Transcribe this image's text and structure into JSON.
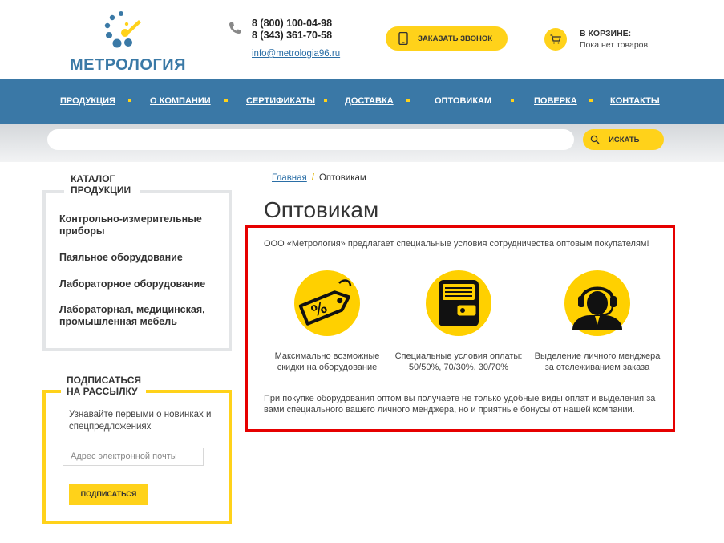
{
  "header": {
    "logo_text": "МЕТРОЛОГИЯ",
    "phone_1": "8 (800) 100-04-98",
    "phone_2": "8 (343) 361-70-58",
    "email": "info@metrologia96.ru",
    "callback_label": "ЗАКАЗАТЬ ЗВОНОК",
    "cart_title": "В КОРЗИНЕ:",
    "cart_status": "Пока нет товаров"
  },
  "nav": {
    "items": [
      {
        "label": "ПРОДУКЦИЯ"
      },
      {
        "label": "О КОМПАНИИ"
      },
      {
        "label": "СЕРТИФИКАТЫ"
      },
      {
        "label": "ДОСТАВКА"
      },
      {
        "label": "ОПТОВИКАМ"
      },
      {
        "label": "ПОВЕРКА"
      },
      {
        "label": "КОНТАКТЫ"
      }
    ]
  },
  "search": {
    "placeholder": "",
    "button_label": "ИСКАТЬ"
  },
  "catalog": {
    "title_line1": "КАТАЛОГ",
    "title_line2": "ПРОДУКЦИИ",
    "items": [
      {
        "line1": "Контрольно-измерительные",
        "line2": "приборы"
      },
      {
        "line1": "Паяльное оборудование",
        "line2": ""
      },
      {
        "line1": "Лабораторное оборудование",
        "line2": ""
      },
      {
        "line1": "Лабораторная, медицинская,",
        "line2": "промышленная мебель"
      }
    ]
  },
  "subscribe": {
    "title_line1": "ПОДПИСАТЬСЯ",
    "title_line2": "НА РАССЫЛКУ",
    "text": "Узнавайте первыми о новинках и спецпредложениях",
    "email_placeholder": "Адрес электронной почты",
    "button_label": "ПОДПИСАТЬСЯ"
  },
  "breadcrumb": {
    "home": "Главная",
    "separator": "/",
    "current": "Оптовикам"
  },
  "main": {
    "title": "Оптовикам",
    "intro": "ООО «Метрология» предлагает специальные условия сотрудничества оптовым покупателям!",
    "features": [
      {
        "icon": "discount-tag-icon",
        "line1": "Максимально возможные",
        "line2": "скидки на оборудование"
      },
      {
        "icon": "wallet-icon",
        "line1": "Специальные условия оплаты:",
        "line2": "50/50%, 70/30%, 30/70%"
      },
      {
        "icon": "manager-headset-icon",
        "line1": "Выделение личного менджера",
        "line2": "за отслеживанием заказа"
      }
    ],
    "outro": "При покупке оборудования оптом вы получаете не только удобные виды оплат и выделения за вами специального вашего личного менджера, но и приятные бонусы от нашей компании."
  },
  "colors": {
    "accent_yellow": "#ffd21a",
    "nav_blue": "#3a78a6",
    "highlight_red": "#e60000"
  }
}
